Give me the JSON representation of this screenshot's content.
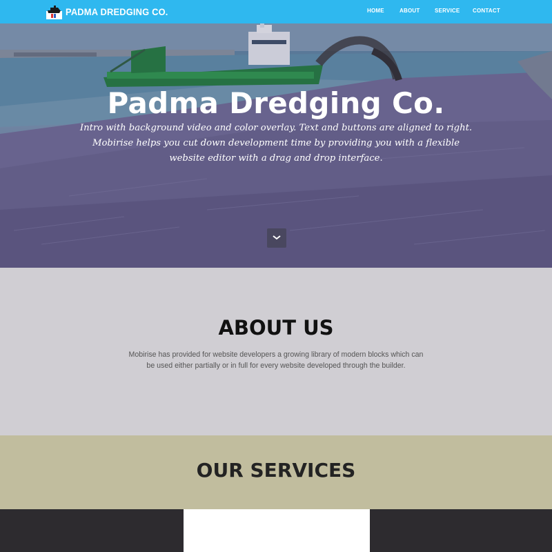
{
  "colors": {
    "navbar": "#2fb8ef",
    "about_bg": "#d0ced3",
    "services_bg": "#c1bd9e",
    "dark_bg": "#2d2b2f"
  },
  "navbar": {
    "brand_name": "PADMA DREDGING CO.",
    "logo_icon": "ship-logo-icon",
    "links": [
      {
        "label": "HOME"
      },
      {
        "label": "ABOUT"
      },
      {
        "label": "SERVICE"
      },
      {
        "label": "CONTACT"
      }
    ]
  },
  "hero": {
    "title": "Padma Dredging Co.",
    "text": "Intro with background video and color overlay. Text and buttons are aligned to right. Mobirise helps you cut down development time by providing you with a flexible website editor with a drag and drop interface.",
    "scroll_icon": "chevron-down-icon"
  },
  "about": {
    "title": "ABOUT US",
    "text": "Mobirise has provided for website developers a growing library of modern blocks which can be used either partially or in full for every website developed through the builder."
  },
  "services": {
    "title": "OUR SERVICES"
  }
}
